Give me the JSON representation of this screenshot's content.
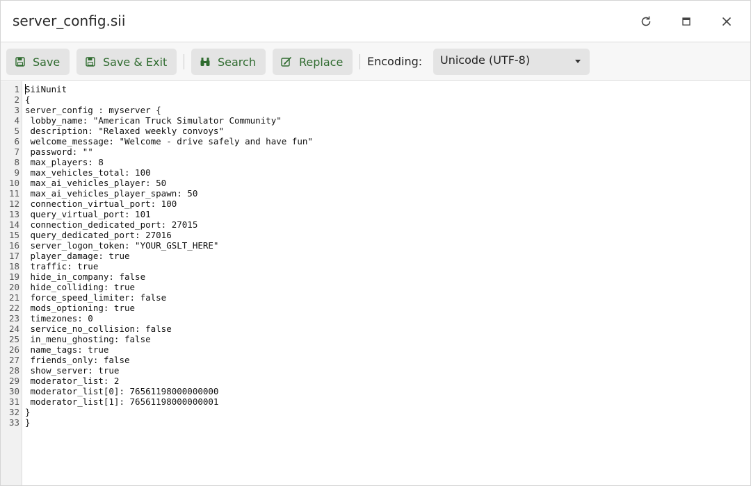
{
  "window": {
    "title": "server_config.sii"
  },
  "titlebar": {
    "refresh_icon": "refresh-icon",
    "maximize_icon": "maximize-icon",
    "close_icon": "close-icon"
  },
  "toolbar": {
    "save_label": "Save",
    "save_exit_label": "Save & Exit",
    "search_label": "Search",
    "replace_label": "Replace",
    "encoding_label": "Encoding:",
    "encoding_value": "Unicode (UTF-8)",
    "accent_color": "#2f6b2f"
  },
  "editor": {
    "lines": [
      {
        "num": "1",
        "text": "SiiNunit"
      },
      {
        "num": "2",
        "text": "{"
      },
      {
        "num": "3",
        "text": "server_config : myserver {"
      },
      {
        "num": "4",
        "text": " lobby_name: \"American Truck Simulator Community\""
      },
      {
        "num": "5",
        "text": " description: \"Relaxed weekly convoys\""
      },
      {
        "num": "6",
        "text": " welcome_message: \"Welcome - drive safely and have fun\""
      },
      {
        "num": "7",
        "text": " password: \"\""
      },
      {
        "num": "8",
        "text": " max_players: 8"
      },
      {
        "num": "9",
        "text": " max_vehicles_total: 100"
      },
      {
        "num": "10",
        "text": " max_ai_vehicles_player: 50"
      },
      {
        "num": "11",
        "text": " max_ai_vehicles_player_spawn: 50"
      },
      {
        "num": "12",
        "text": " connection_virtual_port: 100"
      },
      {
        "num": "13",
        "text": " query_virtual_port: 101"
      },
      {
        "num": "14",
        "text": " connection_dedicated_port: 27015"
      },
      {
        "num": "15",
        "text": " query_dedicated_port: 27016"
      },
      {
        "num": "16",
        "text": " server_logon_token: \"YOUR_GSLT_HERE\""
      },
      {
        "num": "17",
        "text": " player_damage: true"
      },
      {
        "num": "18",
        "text": " traffic: true"
      },
      {
        "num": "19",
        "text": " hide_in_company: false"
      },
      {
        "num": "20",
        "text": " hide_colliding: true"
      },
      {
        "num": "21",
        "text": " force_speed_limiter: false"
      },
      {
        "num": "22",
        "text": " mods_optioning: true"
      },
      {
        "num": "23",
        "text": " timezones: 0"
      },
      {
        "num": "24",
        "text": " service_no_collision: false"
      },
      {
        "num": "25",
        "text": " in_menu_ghosting: false"
      },
      {
        "num": "26",
        "text": " name_tags: true"
      },
      {
        "num": "27",
        "text": " friends_only: false"
      },
      {
        "num": "28",
        "text": " show_server: true"
      },
      {
        "num": "29",
        "text": " moderator_list: 2"
      },
      {
        "num": "30",
        "text": " moderator_list[0]: 76561198000000000"
      },
      {
        "num": "31",
        "text": " moderator_list[1]: 76561198000000001"
      },
      {
        "num": "32",
        "text": "}"
      },
      {
        "num": "33",
        "text": "}"
      }
    ]
  }
}
